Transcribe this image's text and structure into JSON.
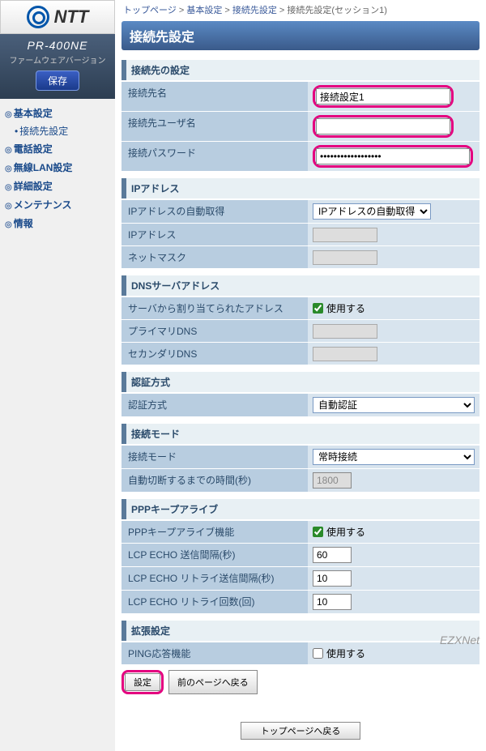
{
  "brand": "NTT",
  "model": "PR-400NE",
  "firmware": "ファームウェアバージョン",
  "save": "保存",
  "nav": {
    "basic": "基本設定",
    "conn": "接続先設定",
    "tel": "電話設定",
    "wlan": "無線LAN設定",
    "detail": "詳細設定",
    "maint": "メンテナンス",
    "info": "情報"
  },
  "breadcrumb": {
    "top": "トップページ",
    "basic": "基本設定",
    "conn": "接続先設定",
    "current": "接続先設定(セッション1)"
  },
  "title": "接続先設定",
  "sections": {
    "conn": {
      "hdr": "接続先の設定",
      "name_lbl": "接続先名",
      "name_val": "接続設定1",
      "user_lbl": "接続先ユーザ名",
      "user_val": "",
      "pass_lbl": "接続パスワード",
      "pass_val": "••••••••••••••••••"
    },
    "ip": {
      "hdr": "IPアドレス",
      "auto_lbl": "IPアドレスの自動取得",
      "auto_val": "IPアドレスの自動取得",
      "addr_lbl": "IPアドレス",
      "mask_lbl": "ネットマスク"
    },
    "dns": {
      "hdr": "DNSサーバアドレス",
      "server_lbl": "サーバから割り当てられたアドレス",
      "use": "使用する",
      "pri_lbl": "プライマリDNS",
      "sec_lbl": "セカンダリDNS"
    },
    "auth": {
      "hdr": "認証方式",
      "method_lbl": "認証方式",
      "method_val": "自動認証"
    },
    "mode": {
      "hdr": "接続モード",
      "mode_lbl": "接続モード",
      "mode_val": "常時接続",
      "timeout_lbl": "自動切断するまでの時間(秒)",
      "timeout_val": "1800"
    },
    "ppp": {
      "hdr": "PPPキープアライブ",
      "func_lbl": "PPPキープアライブ機能",
      "use": "使用する",
      "interval_lbl": "LCP ECHO 送信間隔(秒)",
      "interval_val": "60",
      "retry_int_lbl": "LCP ECHO リトライ送信間隔(秒)",
      "retry_int_val": "10",
      "retry_cnt_lbl": "LCP ECHO リトライ回数(回)",
      "retry_cnt_val": "10"
    },
    "ext": {
      "hdr": "拡張設定",
      "ping_lbl": "PING応答機能",
      "use": "使用する"
    }
  },
  "buttons": {
    "set": "設定",
    "back": "前のページへ戻る",
    "top": "トップページへ戻る"
  },
  "watermark": "EZXNet"
}
